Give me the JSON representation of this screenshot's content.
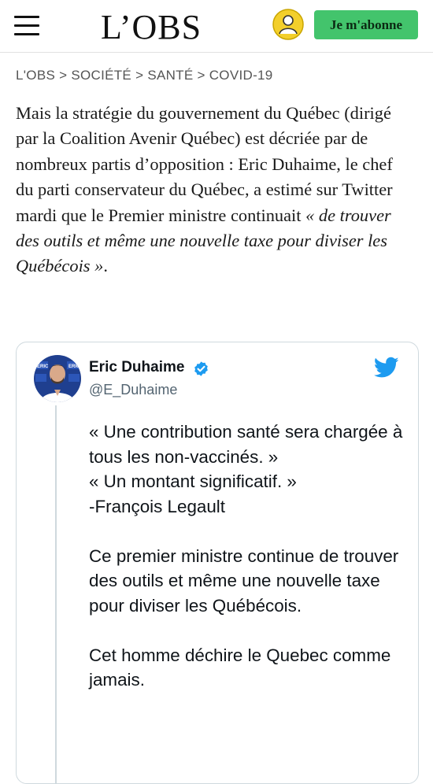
{
  "header": {
    "logo": "L’OBS",
    "subscribe_label": "Je m'abonne"
  },
  "breadcrumb": [
    "L'OBS",
    "SOCIÉTÉ",
    "SANTÉ",
    "COVID-19"
  ],
  "breadcrumb_separator": ">",
  "article": {
    "paragraph_plain": "Mais la stratégie du gouvernement du Québec (dirigé par la Coalition Avenir Québec) est décriée par de nombreux partis d’opposition : Eric Duhaime, le chef du parti conservateur du Québec, a estimé sur Twitter mardi que le Premier ministre continuait ",
    "paragraph_quote": "« de trouver des outils et même une nouvelle taxe pour diviser les Québécois »",
    "paragraph_end": "."
  },
  "tweet": {
    "author_name": "Eric Duhaime",
    "handle": "@E_Duhaime",
    "avatar_banner_text": "ERIC",
    "lines": [
      "« Une contribution santé sera chargée à tous les non-vaccinés. »",
      "« Un montant significatif. »",
      "-François Legault",
      "",
      "Ce premier ministre continue de trouver des outils et même une nouvelle taxe pour diviser les Québécois.",
      "",
      "Cet homme déchire le Quebec comme jamais."
    ]
  },
  "colors": {
    "subscribe_green": "#43c46c",
    "twitter_blue": "#1d9bf0",
    "account_icon_yellow": "#f3cf2b"
  }
}
